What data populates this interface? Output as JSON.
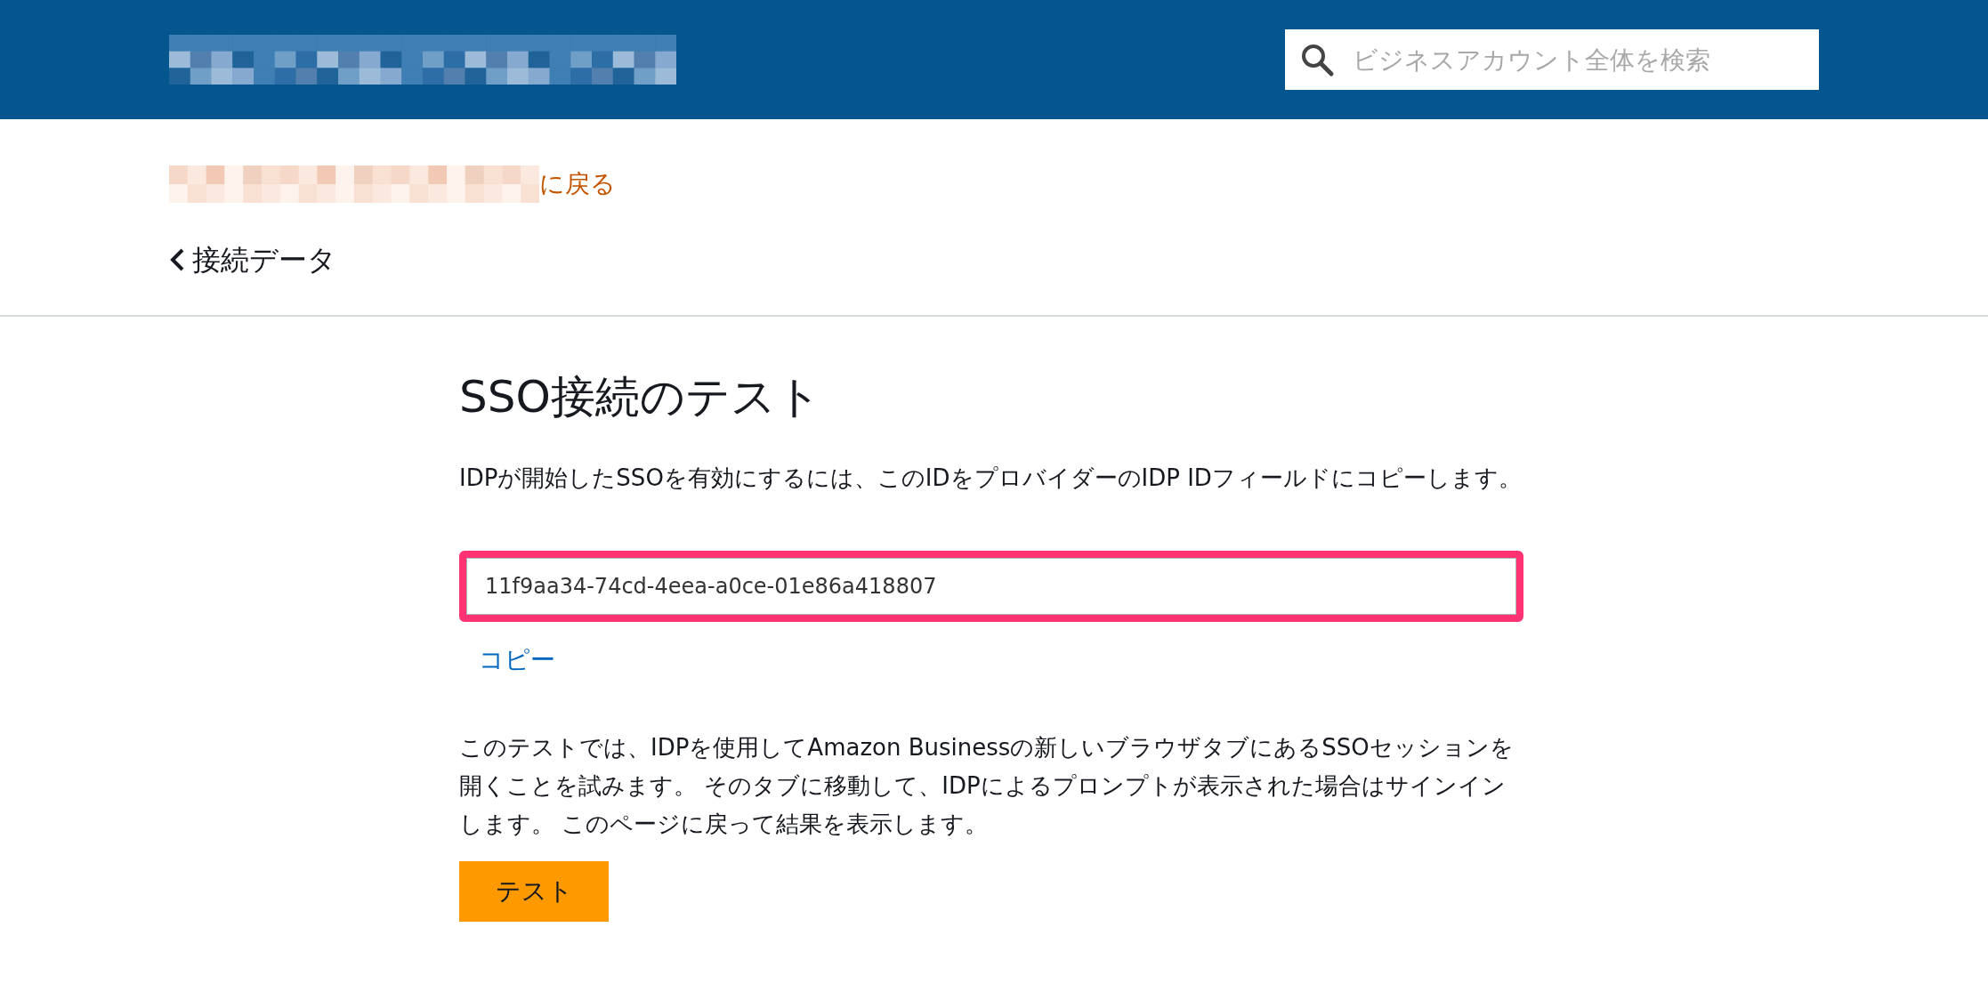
{
  "header": {
    "search": {
      "placeholder": "ビジネスアカウント全体を検索"
    }
  },
  "breadcrumb": {
    "link": "に戻る"
  },
  "back_link": "接続データ",
  "title": "SSO接続のテスト",
  "description": "IDPが開始したSSOを有効にするには、このIDをプロバイダーのIDP IDフィールドにコピーします。",
  "id_field": {
    "value": "11f9aa34-74cd-4eea-a0ce-01e86a418807",
    "highlighted": true
  },
  "copy_link": "コピー",
  "instructions": "このテストでは、IDPを使用してAmazon Businessの新しいブラウザタブにあるSSOセッションを開くことを試みます。 そのタブに移動して、IDPによるプロンプトが表示された場合はサインインします。 このページに戻って結果を表示します。",
  "test_button": "テスト"
}
